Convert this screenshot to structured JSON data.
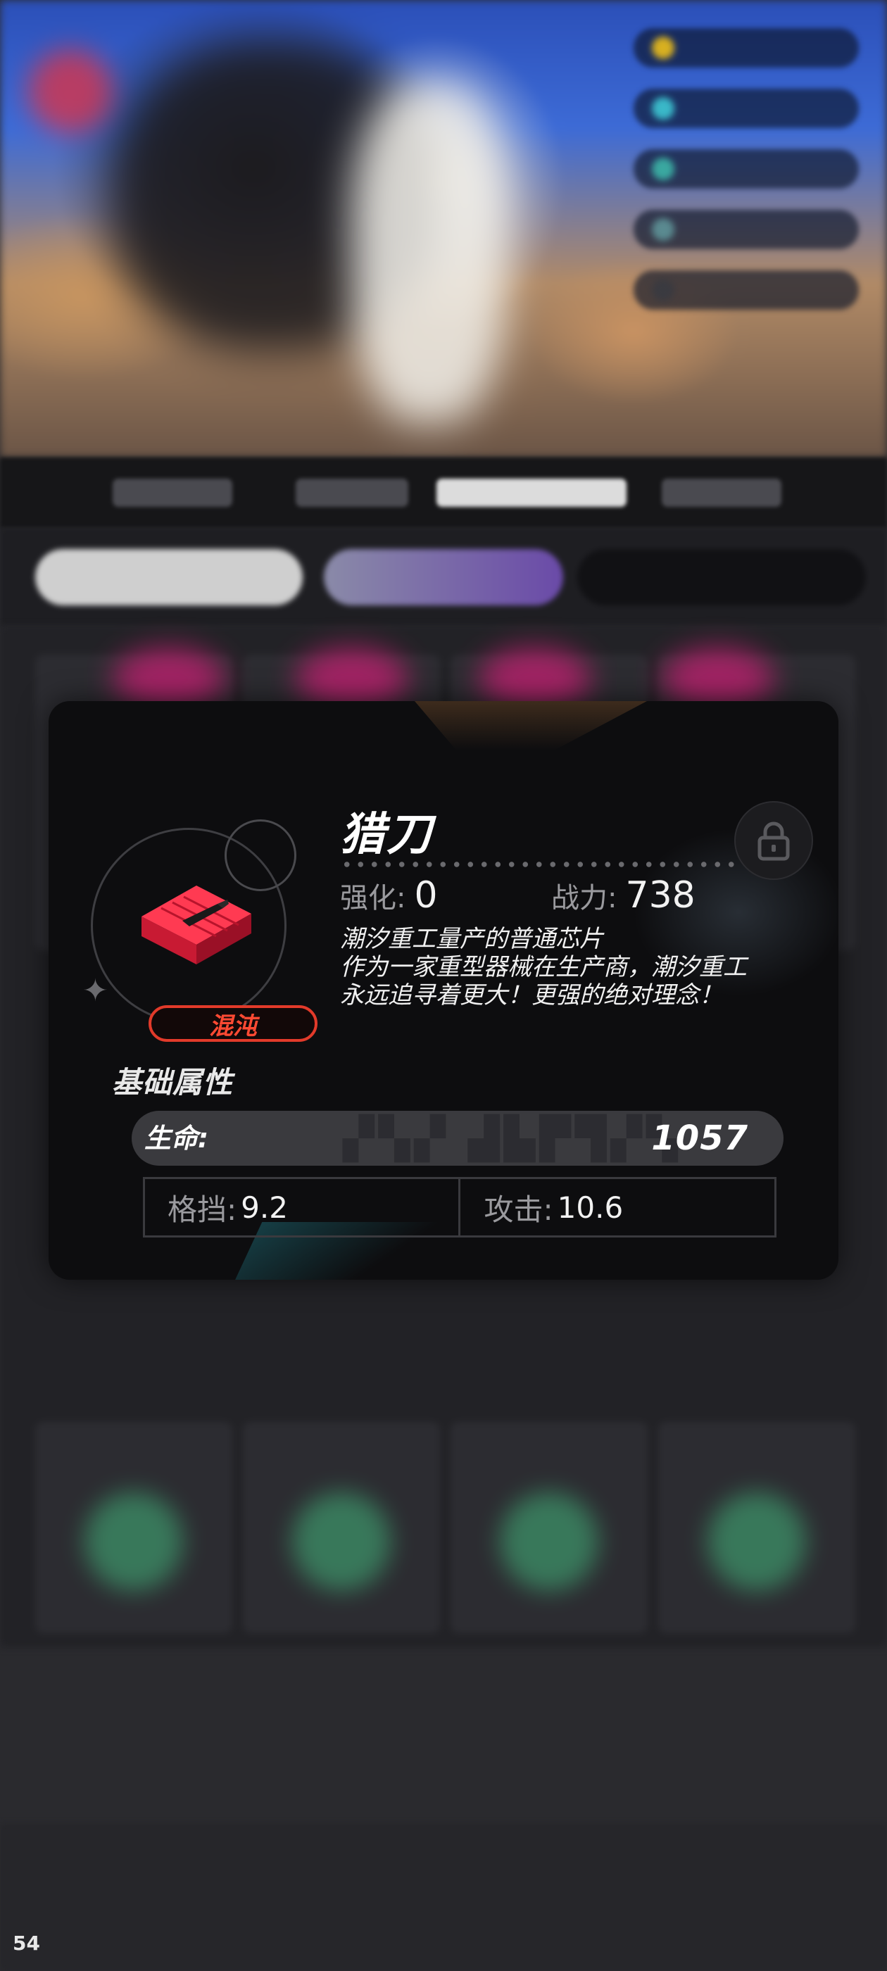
{
  "chip": {
    "name": "猎刀",
    "rarity": "混沌",
    "enhance_label": "强化:",
    "enhance_value": "0",
    "power_label": "战力:",
    "power_value": "738",
    "description": [
      "潮汐重工量产的普通芯片",
      "作为一家重型器械在生产商，潮汐重工",
      "永远追寻着更大！更强的绝对理念！"
    ],
    "icon": "red-chip-blade-icon"
  },
  "attributes": {
    "title": "基础属性",
    "main_label": "生命:",
    "main_value": "1057",
    "sub": [
      {
        "label": "格挡:",
        "value": "9.2"
      },
      {
        "label": "攻击:",
        "value": "10.6"
      }
    ]
  },
  "lock": {
    "icon": "lock-icon"
  },
  "fps_counter": "54",
  "colors": {
    "rarity": "#e23a2a",
    "panel_bg": "#0d0d0f",
    "bar_bg": "#3a3a3e"
  }
}
